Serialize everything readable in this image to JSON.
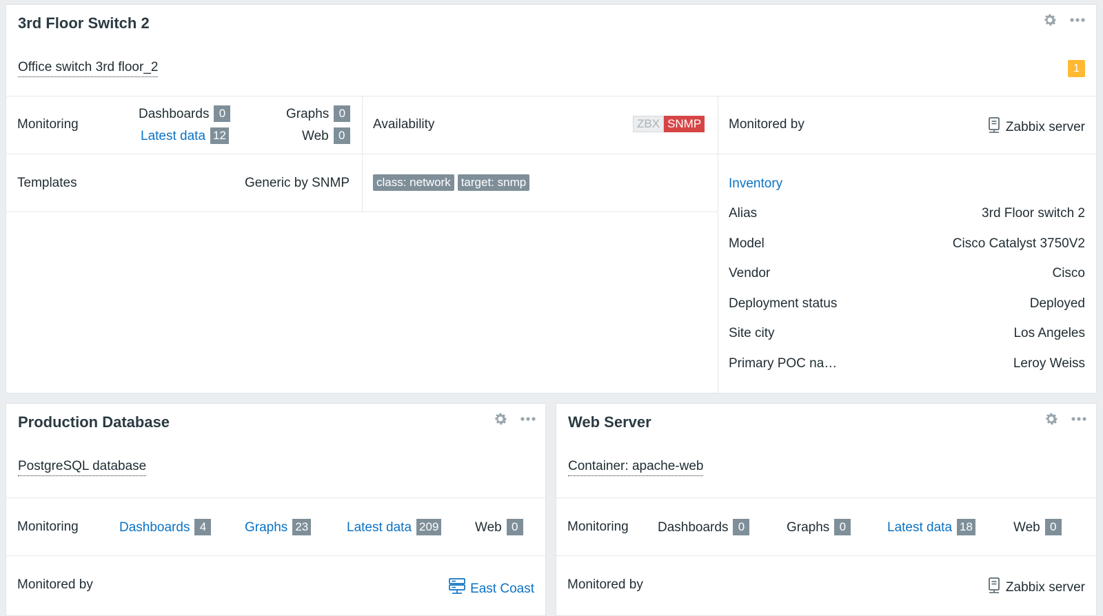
{
  "widget1": {
    "title": "3rd Floor Switch 2",
    "description": "Office switch 3rd floor_2",
    "problems": "1",
    "monitoring": {
      "label": "Monitoring",
      "dashboards": "Dashboards",
      "dashboards_count": "0",
      "graphs": "Graphs",
      "graphs_count": "0",
      "latest_data": "Latest data",
      "latest_data_count": "12",
      "web": "Web",
      "web_count": "0"
    },
    "availability": {
      "label": "Availability",
      "zbx": "ZBX",
      "snmp": "SNMP"
    },
    "monitored_by": {
      "label": "Monitored by",
      "value": "Zabbix server"
    },
    "templates": {
      "label": "Templates",
      "value": "Generic by SNMP"
    },
    "tags": [
      "class: network",
      "target: snmp"
    ],
    "inventory": {
      "title": "Inventory",
      "rows": [
        {
          "k": "Alias",
          "v": "3rd Floor switch 2"
        },
        {
          "k": "Model",
          "v": "Cisco Catalyst 3750V2"
        },
        {
          "k": "Vendor",
          "v": "Cisco"
        },
        {
          "k": "Deployment status",
          "v": "Deployed"
        },
        {
          "k": "Site city",
          "v": "Los Angeles"
        },
        {
          "k": "Primary POC na…",
          "v": "Leroy Weiss"
        }
      ]
    }
  },
  "widget2": {
    "title": "Production Database",
    "description": "PostgreSQL database",
    "monitoring": {
      "label": "Monitoring",
      "dashboards": "Dashboards",
      "dashboards_count": "4",
      "graphs": "Graphs",
      "graphs_count": "23",
      "latest_data": "Latest data",
      "latest_data_count": "209",
      "web": "Web",
      "web_count": "0"
    },
    "monitored_by": {
      "label": "Monitored by",
      "value": "East Coast"
    }
  },
  "widget3": {
    "title": "Web Server",
    "description": "Container: apache-web",
    "monitoring": {
      "label": "Monitoring",
      "dashboards": "Dashboards",
      "dashboards_count": "0",
      "graphs": "Graphs",
      "graphs_count": "0",
      "latest_data": "Latest data",
      "latest_data_count": "18",
      "web": "Web",
      "web_count": "0"
    },
    "monitored_by": {
      "label": "Monitored by",
      "value": "Zabbix server"
    }
  },
  "colors": {
    "link": "#0b72c4",
    "badge": "#7f8f99",
    "snmp_error": "#d64546",
    "problem_warning": "#ffb933"
  },
  "icons": [
    "gear-icon",
    "more-icon",
    "zabbix-server-icon",
    "proxy-icon"
  ]
}
